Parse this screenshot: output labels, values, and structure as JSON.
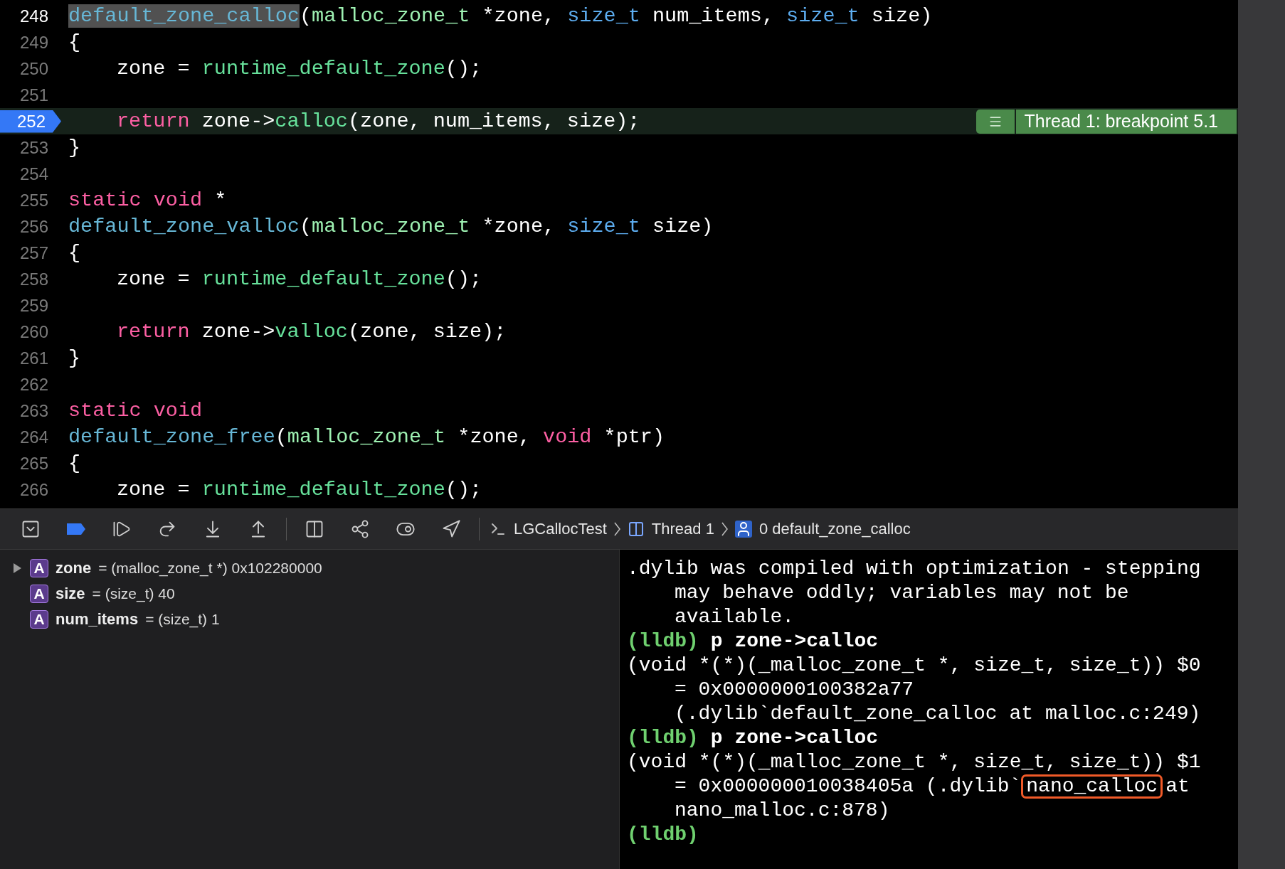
{
  "editor": {
    "lines": [
      {
        "number": "248",
        "cursor": true,
        "breakpoint": false,
        "indent": false,
        "tokens": [
          {
            "t": "default_zone_calloc",
            "kind": "decl",
            "selected": true
          },
          {
            "t": "(",
            "kind": "plain",
            "selected": false
          },
          {
            "t": "malloc_zone_t",
            "kind": "type",
            "selected": false
          },
          {
            "t": " *zone, ",
            "kind": "plain",
            "selected": false
          },
          {
            "t": "size_t",
            "kind": "builtin",
            "selected": false
          },
          {
            "t": " num_items, ",
            "kind": "plain",
            "selected": false
          },
          {
            "t": "size_t",
            "kind": "builtin",
            "selected": false
          },
          {
            "t": " size)",
            "kind": "plain",
            "selected": false
          }
        ]
      },
      {
        "number": "249",
        "cursor": false,
        "breakpoint": false,
        "indent": false,
        "tokens": [
          {
            "t": "{",
            "kind": "plain",
            "selected": false
          }
        ]
      },
      {
        "number": "250",
        "cursor": false,
        "breakpoint": false,
        "indent": true,
        "tokens": [
          {
            "t": "zone = ",
            "kind": "plain",
            "selected": false
          },
          {
            "t": "runtime_default_zone",
            "kind": "call",
            "selected": false
          },
          {
            "t": "();",
            "kind": "plain",
            "selected": false
          }
        ]
      },
      {
        "number": "251",
        "cursor": false,
        "breakpoint": false
      },
      {
        "number": "252",
        "cursor": false,
        "breakpoint": true,
        "indent": true,
        "annotation": "Thread 1: breakpoint 5.1",
        "tokens": [
          {
            "t": "return",
            "kind": "keyword",
            "selected": false
          },
          {
            "t": " zone->",
            "kind": "plain",
            "selected": false
          },
          {
            "t": "calloc",
            "kind": "call",
            "selected": false
          },
          {
            "t": "(zone, num_items, size);",
            "kind": "plain",
            "selected": false
          }
        ]
      },
      {
        "number": "253",
        "cursor": false,
        "breakpoint": false,
        "indent": false,
        "tokens": [
          {
            "t": "}",
            "kind": "plain",
            "selected": false
          }
        ]
      },
      {
        "number": "254",
        "cursor": false,
        "breakpoint": false
      },
      {
        "number": "255",
        "cursor": false,
        "breakpoint": false,
        "indent": false,
        "tokens": [
          {
            "t": "static void",
            "kind": "keyword",
            "selected": false
          },
          {
            "t": " *",
            "kind": "plain",
            "selected": false
          }
        ]
      },
      {
        "number": "256",
        "cursor": false,
        "breakpoint": false,
        "indent": false,
        "tokens": [
          {
            "t": "default_zone_valloc",
            "kind": "decl",
            "selected": false
          },
          {
            "t": "(",
            "kind": "plain",
            "selected": false
          },
          {
            "t": "malloc_zone_t",
            "kind": "type",
            "selected": false
          },
          {
            "t": " *zone, ",
            "kind": "plain",
            "selected": false
          },
          {
            "t": "size_t",
            "kind": "builtin",
            "selected": false
          },
          {
            "t": " size)",
            "kind": "plain",
            "selected": false
          }
        ]
      },
      {
        "number": "257",
        "cursor": false,
        "breakpoint": false,
        "indent": false,
        "tokens": [
          {
            "t": "{",
            "kind": "plain",
            "selected": false
          }
        ]
      },
      {
        "number": "258",
        "cursor": false,
        "breakpoint": false,
        "indent": true,
        "tokens": [
          {
            "t": "zone = ",
            "kind": "plain",
            "selected": false
          },
          {
            "t": "runtime_default_zone",
            "kind": "call",
            "selected": false
          },
          {
            "t": "();",
            "kind": "plain",
            "selected": false
          }
        ]
      },
      {
        "number": "259",
        "cursor": false,
        "breakpoint": false
      },
      {
        "number": "260",
        "cursor": false,
        "breakpoint": false,
        "indent": true,
        "tokens": [
          {
            "t": "return",
            "kind": "keyword",
            "selected": false
          },
          {
            "t": " zone->",
            "kind": "plain",
            "selected": false
          },
          {
            "t": "valloc",
            "kind": "call",
            "selected": false
          },
          {
            "t": "(zone, size);",
            "kind": "plain",
            "selected": false
          }
        ]
      },
      {
        "number": "261",
        "cursor": false,
        "breakpoint": false,
        "indent": false,
        "tokens": [
          {
            "t": "}",
            "kind": "plain",
            "selected": false
          }
        ]
      },
      {
        "number": "262",
        "cursor": false,
        "breakpoint": false
      },
      {
        "number": "263",
        "cursor": false,
        "breakpoint": false,
        "indent": false,
        "tokens": [
          {
            "t": "static void",
            "kind": "keyword",
            "selected": false
          }
        ]
      },
      {
        "number": "264",
        "cursor": false,
        "breakpoint": false,
        "indent": false,
        "tokens": [
          {
            "t": "default_zone_free",
            "kind": "decl",
            "selected": false
          },
          {
            "t": "(",
            "kind": "plain",
            "selected": false
          },
          {
            "t": "malloc_zone_t",
            "kind": "type",
            "selected": false
          },
          {
            "t": " *zone, ",
            "kind": "plain",
            "selected": false
          },
          {
            "t": "void",
            "kind": "keyword",
            "selected": false
          },
          {
            "t": " *ptr)",
            "kind": "plain",
            "selected": false
          }
        ]
      },
      {
        "number": "265",
        "cursor": false,
        "breakpoint": false,
        "indent": false,
        "tokens": [
          {
            "t": "{",
            "kind": "plain",
            "selected": false
          }
        ]
      },
      {
        "number": "266",
        "cursor": false,
        "breakpoint": false,
        "indent": true,
        "tokens": [
          {
            "t": "zone = ",
            "kind": "plain",
            "selected": false
          },
          {
            "t": "runtime_default_zone",
            "kind": "call",
            "selected": false
          },
          {
            "t": "();",
            "kind": "plain",
            "selected": false
          }
        ]
      }
    ]
  },
  "debug_bar": {
    "breadcrumbs": [
      {
        "label": "LGCallocTest",
        "kind": "app"
      },
      {
        "label": "Thread 1",
        "kind": "thread"
      },
      {
        "label": "0 default_zone_calloc",
        "kind": "frame"
      }
    ]
  },
  "variables": [
    {
      "badge": "A",
      "name": "zone",
      "detail": "= (malloc_zone_t *) 0x102280000",
      "expandable": true
    },
    {
      "badge": "A",
      "name": "size",
      "detail": "= (size_t) 40",
      "expandable": false
    },
    {
      "badge": "A",
      "name": "num_items",
      "detail": "= (size_t) 1",
      "expandable": false
    }
  ],
  "console": [
    {
      "indent": false,
      "segments": [
        {
          "t": ".dylib was compiled with optimization - stepping",
          "kind": "output"
        }
      ]
    },
    {
      "indent": true,
      "segments": [
        {
          "t": "may behave oddly; variables may not be",
          "kind": "output"
        }
      ]
    },
    {
      "indent": true,
      "segments": [
        {
          "t": "available.",
          "kind": "output"
        }
      ]
    },
    {
      "indent": false,
      "segments": [
        {
          "t": "(lldb)",
          "kind": "prompt"
        },
        {
          "t": "p zone->calloc",
          "kind": "command"
        }
      ]
    },
    {
      "indent": false,
      "segments": [
        {
          "t": "(void *(*)(_malloc_zone_t *, size_t, size_t)) $0",
          "kind": "output"
        }
      ]
    },
    {
      "indent": true,
      "segments": [
        {
          "t": "= 0x0000000100382a77",
          "kind": "output"
        }
      ]
    },
    {
      "indent": true,
      "segments": [
        {
          "t": "(.dylib`default_zone_calloc at malloc.c:249)",
          "kind": "output"
        }
      ]
    },
    {
      "indent": false,
      "segments": [
        {
          "t": "(lldb)",
          "kind": "prompt"
        },
        {
          "t": "p zone->calloc",
          "kind": "command"
        }
      ]
    },
    {
      "indent": false,
      "segments": [
        {
          "t": "(void *(*)(_malloc_zone_t *, size_t, size_t)) $1",
          "kind": "output"
        }
      ]
    },
    {
      "indent": true,
      "segments": [
        {
          "t": "= 0x000000010038405a (.dylib`",
          "kind": "output"
        },
        {
          "t": "nano_calloc",
          "kind": "boxed"
        },
        {
          "t": "at",
          "kind": "output"
        }
      ]
    },
    {
      "indent": true,
      "segments": [
        {
          "t": "nano_malloc.c:878)",
          "kind": "output"
        }
      ]
    },
    {
      "indent": false,
      "segments": [
        {
          "t": "(lldb)",
          "kind": "prompt"
        }
      ]
    }
  ]
}
